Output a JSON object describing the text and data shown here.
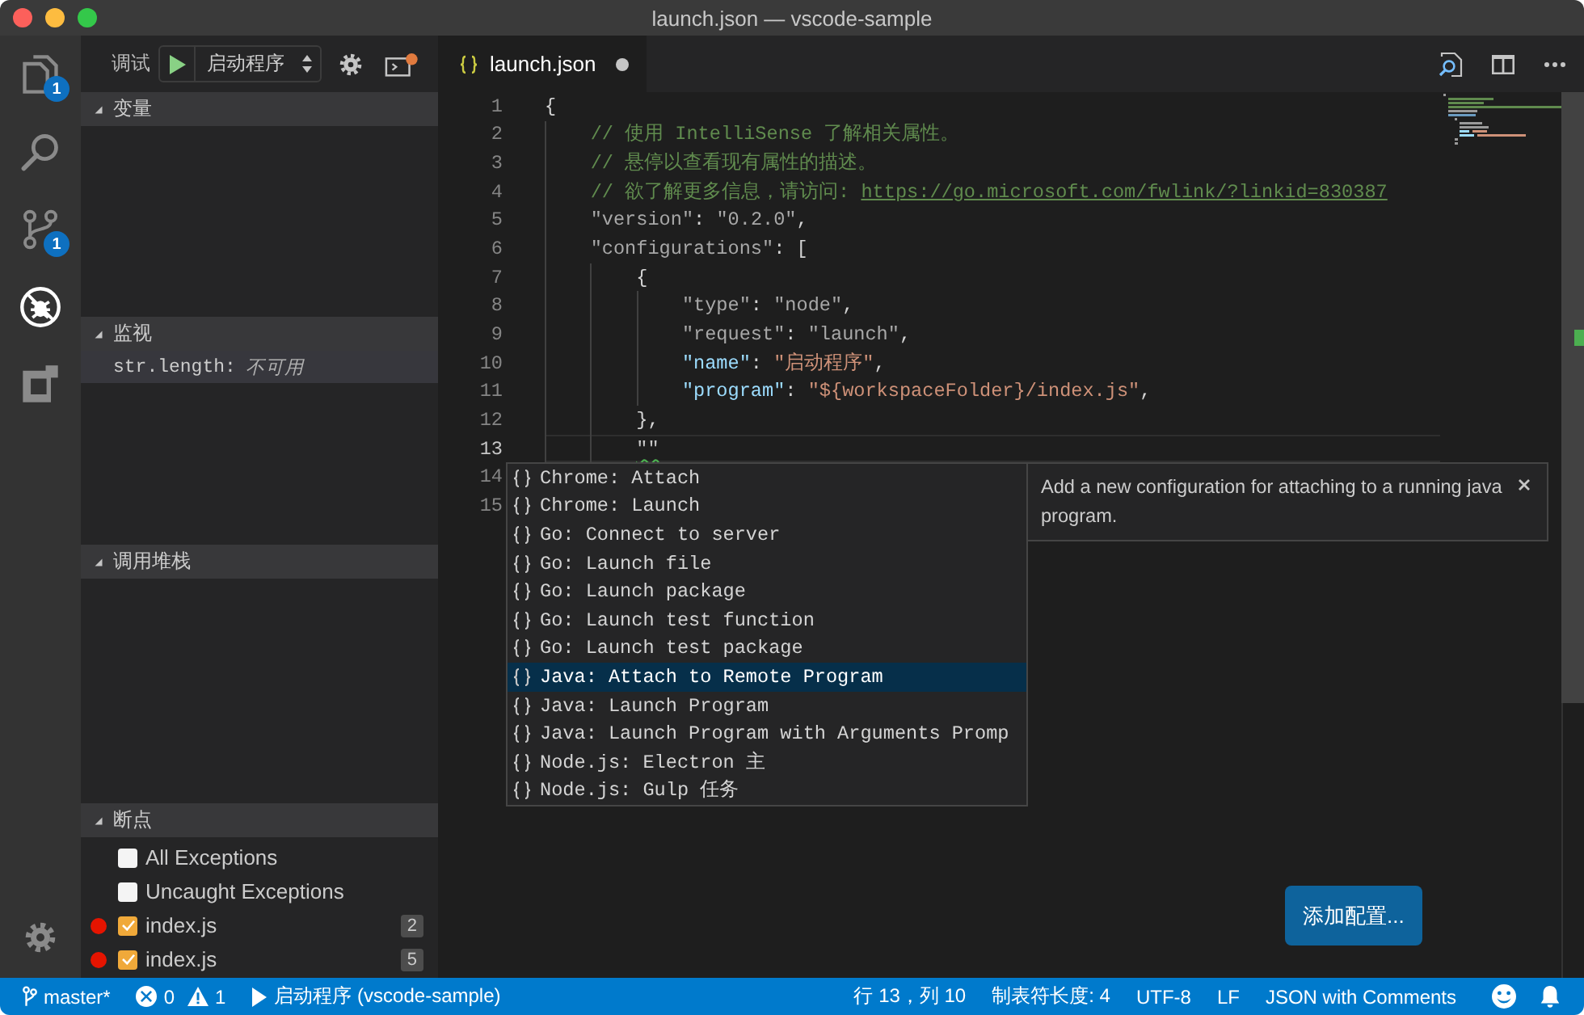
{
  "window": {
    "title": "launch.json — vscode-sample"
  },
  "activity_bar": {
    "items": [
      {
        "kind": "files",
        "badge": "1",
        "selected": false
      },
      {
        "kind": "search",
        "selected": false
      },
      {
        "kind": "source-control",
        "badge": "1",
        "selected": false
      },
      {
        "kind": "debug",
        "selected": true
      },
      {
        "kind": "extensions",
        "selected": false
      }
    ]
  },
  "sidebar": {
    "toolbar": {
      "label": "调试",
      "configuration": "启动程序"
    },
    "variables": {
      "title": "变量",
      "expanded": true
    },
    "watch": {
      "title": "监视",
      "expanded": true,
      "items": [
        {
          "expression": "str.length:",
          "value": "不可用",
          "selected": true
        }
      ]
    },
    "call_stack": {
      "title": "调用堆栈",
      "expanded": true
    },
    "breakpoints": {
      "title": "断点",
      "expanded": true,
      "items": [
        {
          "kind": "exception",
          "label": "All Exceptions",
          "checked": false
        },
        {
          "kind": "exception",
          "label": "Uncaught Exceptions",
          "checked": false
        },
        {
          "kind": "file",
          "label": "index.js",
          "checked": true,
          "line": "2"
        },
        {
          "kind": "file",
          "label": "index.js",
          "checked": true,
          "line": "5"
        }
      ]
    }
  },
  "editor": {
    "tabs": [
      {
        "title": "launch.json",
        "modified": true,
        "selected": true
      }
    ],
    "lines": [
      {
        "number": "1",
        "current": false,
        "tokens": [
          {
            "kind": "punct",
            "text": "{"
          }
        ],
        "children": [
          {
            "number": "2",
            "current": false,
            "tokens": [
              {
                "kind": "comment",
                "text": "// 使用 IntelliSense 了解相关属性。"
              }
            ]
          },
          {
            "number": "3",
            "current": false,
            "tokens": [
              {
                "kind": "comment",
                "text": "// 悬停以查看现有属性的描述。"
              }
            ]
          },
          {
            "number": "4",
            "current": false,
            "tokens": [
              {
                "kind": "comment",
                "text": "// 欲了解更多信息，请访问: "
              },
              {
                "kind": "link",
                "text": "https://go.microsoft.com/fwlink/?linkid=830387"
              }
            ]
          },
          {
            "number": "5",
            "current": false,
            "tokens": [
              {
                "kind": "dim",
                "text": "\"version\""
              },
              {
                "kind": "punct",
                "text": ": "
              },
              {
                "kind": "dim",
                "text": "\"0.2.0\""
              },
              {
                "kind": "punct",
                "text": ","
              }
            ]
          },
          {
            "number": "6",
            "current": false,
            "tokens": [
              {
                "kind": "dim",
                "text": "\"configurations\""
              },
              {
                "kind": "punct",
                "text": ": ["
              }
            ],
            "children": [
              {
                "number": "7",
                "current": false,
                "tokens": [
                  {
                    "kind": "punct",
                    "text": "{"
                  }
                ],
                "children": [
                  {
                    "number": "8",
                    "current": false,
                    "tokens": [
                      {
                        "kind": "dim",
                        "text": "\"type\""
                      },
                      {
                        "kind": "punct",
                        "text": ": "
                      },
                      {
                        "kind": "dim",
                        "text": "\"node\""
                      },
                      {
                        "kind": "punct",
                        "text": ","
                      }
                    ]
                  },
                  {
                    "number": "9",
                    "current": false,
                    "tokens": [
                      {
                        "kind": "dim",
                        "text": "\"request\""
                      },
                      {
                        "kind": "punct",
                        "text": ": "
                      },
                      {
                        "kind": "dim",
                        "text": "\"launch\""
                      },
                      {
                        "kind": "punct",
                        "text": ","
                      }
                    ]
                  },
                  {
                    "number": "10",
                    "current": false,
                    "tokens": [
                      {
                        "kind": "key",
                        "text": "\"name\""
                      },
                      {
                        "kind": "punct",
                        "text": ": "
                      },
                      {
                        "kind": "string",
                        "text": "\"启动程序\""
                      },
                      {
                        "kind": "punct",
                        "text": ","
                      }
                    ]
                  },
                  {
                    "number": "11",
                    "current": false,
                    "tokens": [
                      {
                        "kind": "key",
                        "text": "\"program\""
                      },
                      {
                        "kind": "punct",
                        "text": ": "
                      },
                      {
                        "kind": "string",
                        "text": "\"${workspaceFolder}/index.js\""
                      },
                      {
                        "kind": "punct",
                        "text": ","
                      }
                    ]
                  }
                ]
              },
              {
                "number": "12",
                "current": false,
                "tokens": [
                  {
                    "kind": "punct",
                    "text": "},"
                  }
                ]
              },
              {
                "number": "13",
                "current": true,
                "tokens": [
                  {
                    "kind": "warning",
                    "text": "\"\""
                  }
                ]
              }
            ]
          }
        ]
      },
      {
        "number": "14",
        "current": false
      },
      {
        "number": "15",
        "current": false
      }
    ],
    "suggest": {
      "items": [
        {
          "label": "Chrome: Attach",
          "selected": false
        },
        {
          "label": "Chrome: Launch",
          "selected": false
        },
        {
          "label": "Go: Connect to server",
          "selected": false
        },
        {
          "label": "Go: Launch file",
          "selected": false
        },
        {
          "label": "Go: Launch package",
          "selected": false
        },
        {
          "label": "Go: Launch test function",
          "selected": false
        },
        {
          "label": "Go: Launch test package",
          "selected": false
        },
        {
          "label": "Java: Attach to Remote Program",
          "selected": true
        },
        {
          "label": "Java: Launch Program",
          "selected": false
        },
        {
          "label": "Java: Launch Program with Arguments Promp",
          "selected": false
        },
        {
          "label": "Node.js: Electron 主",
          "selected": false
        },
        {
          "label": "Node.js: Gulp 任务",
          "selected": false
        }
      ]
    },
    "details": {
      "text": "Add a new configuration for attaching to a running java program."
    },
    "action_button": {
      "label": "添加配置..."
    }
  },
  "status_bar": {
    "branch": "master*",
    "errors": "0",
    "warnings": "1",
    "debug_target": "启动程序 (vscode-sample)",
    "items": [
      "行 13，列 10",
      "制表符长度: 4",
      "UTF-8",
      "LF",
      "JSON with Comments"
    ]
  }
}
